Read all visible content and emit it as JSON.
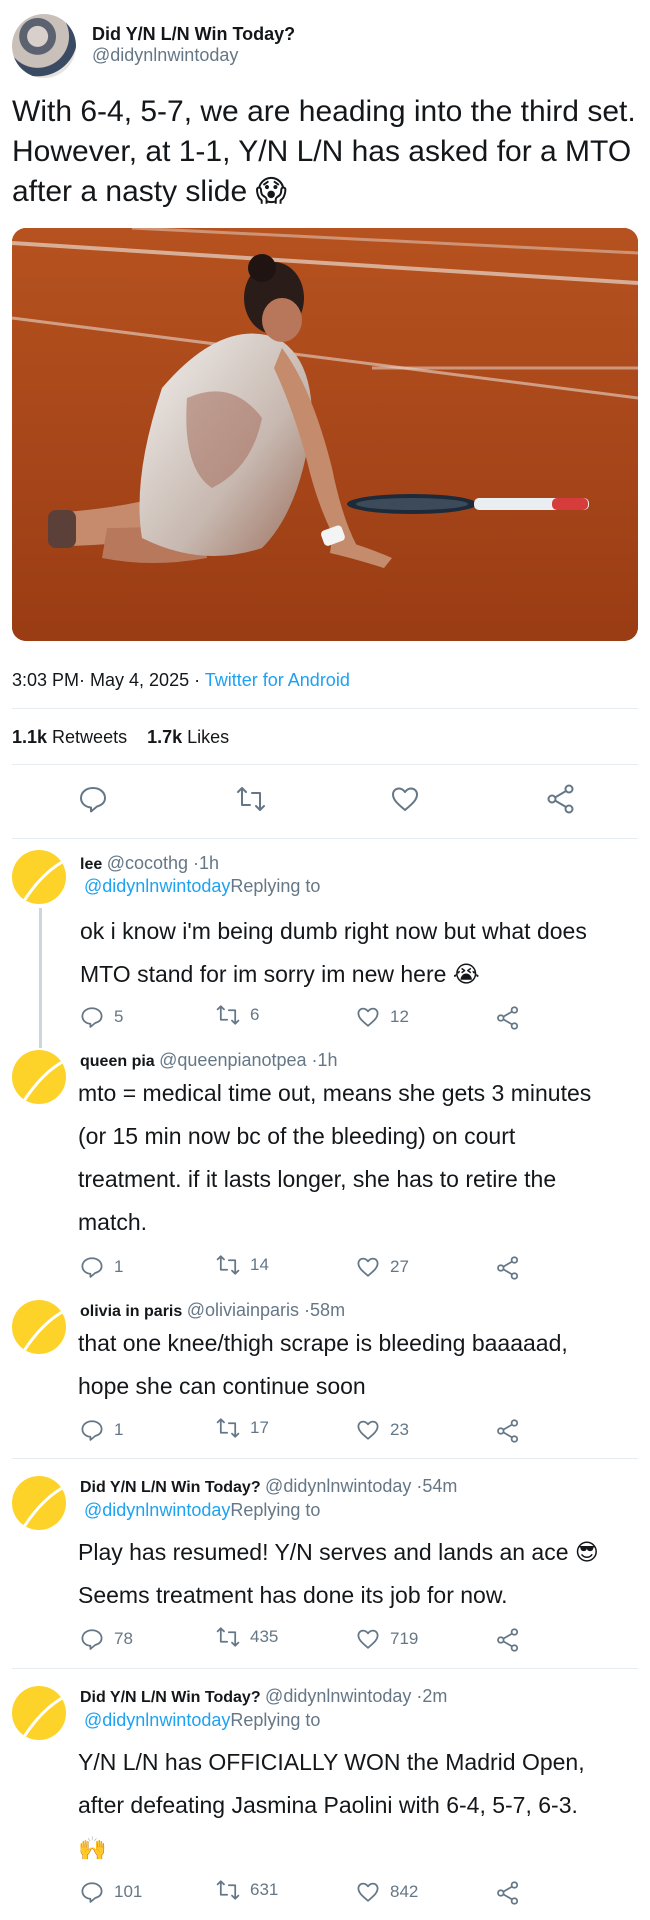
{
  "main": {
    "name": "Did Y/N L/N Win Today?",
    "handle": "@didynlnwintoday",
    "text": "With 6-4, 5-7, we are heading into the third set. However, at 1-1, Y/N L/N has asked for a MTO after a nasty slide 😱",
    "time": "3:03 PM· May 4, 2025",
    "source_sep": " · ",
    "source": "Twitter for Android",
    "retweets_count": "1.1k",
    "retweets_label": " Retweets",
    "likes_count": "1.7k",
    "likes_label": " Likes"
  },
  "replies": [
    {
      "name": "lee",
      "handle": "@cocothg",
      "time": " ·1h",
      "reply_handle": "@didynlnwintoday",
      "reply_label": "Replying to",
      "text_lines": [
        "ok i know i'm being dumb right now but what does",
        "MTO stand for im sorry im new here 😭"
      ],
      "comments": "5",
      "retweets": "6",
      "likes": "12"
    },
    {
      "name": "queen pia",
      "handle": "@queenpianotpea",
      "time": " ·1h",
      "text_lines": [
        "mto = medical time out, means she gets 3 minutes",
        "(or 15 min now bc of the bleeding) on court",
        "treatment. if it lasts longer, she has to retire the",
        "match."
      ],
      "comments": "1",
      "retweets": "14",
      "likes": "27"
    },
    {
      "name": "olivia in paris",
      "handle": "@oliviainparis",
      "time": " ·58m",
      "text_lines": [
        "that one knee/thigh scrape is bleeding baaaaad,",
        "hope she can continue soon"
      ],
      "comments": "1",
      "retweets": "17",
      "likes": "23"
    },
    {
      "name": "Did Y/N L/N Win Today?",
      "handle": "@didynlnwintoday",
      "time": " ·54m",
      "reply_handle": "@didynlnwintoday",
      "reply_label": "Replying to",
      "text_lines": [
        "Play has resumed! Y/N serves and lands an ace 😎",
        "Seems treatment has done its job for now."
      ],
      "comments": "78",
      "retweets": "435",
      "likes": "719"
    },
    {
      "name": "Did Y/N L/N Win Today?",
      "handle": "@didynlnwintoday",
      "time": " ·2m",
      "reply_handle": "@didynlnwintoday",
      "reply_label": "Replying to",
      "text_lines": [
        "Y/N L/N has OFFICIALLY WON the Madrid Open,",
        "after defeating Jasmina Paolini with 6-4, 5-7, 6-3.",
        "🙌"
      ],
      "comments": "101",
      "retweets": "631",
      "likes": "842"
    }
  ],
  "icons": {
    "comment": "comment-icon",
    "retweet": "retweet-icon",
    "like": "heart-icon",
    "share": "share-icon"
  },
  "colors": {
    "link": "#1da1f2",
    "muted": "#657786",
    "avatar_yellow": "#fdd32a"
  }
}
